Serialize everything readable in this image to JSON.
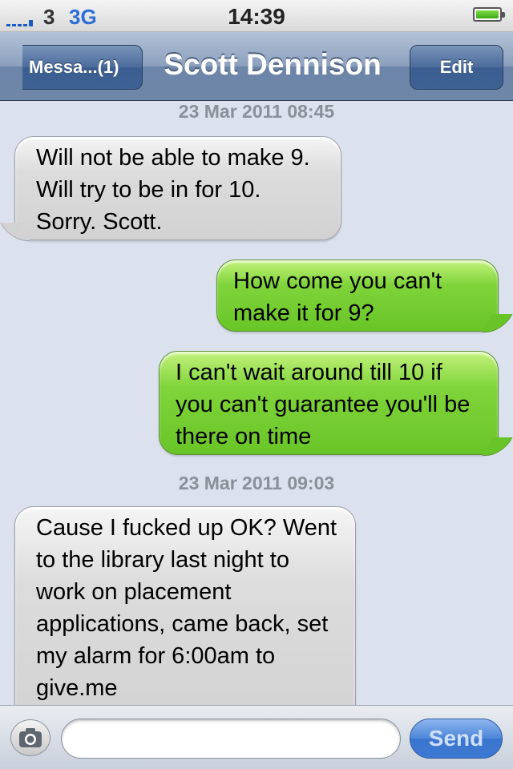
{
  "status_bar": {
    "carrier": "3",
    "network": "3G",
    "time": "14:39",
    "battery_level": 1.0
  },
  "nav": {
    "back_label": "Messa...(1)",
    "title": "Scott Dennison",
    "edit_label": "Edit"
  },
  "messages": [
    {
      "type": "timestamp",
      "text": "23 Mar 2011 08:45"
    },
    {
      "type": "incoming",
      "text": "Will not be able to make 9. Will try to be in for 10. Sorry. Scott."
    },
    {
      "type": "outgoing",
      "text": "How come you can't make it for 9?"
    },
    {
      "type": "outgoing",
      "text": "I can't wait around till 10 if you can't guarantee you'll be there on time"
    },
    {
      "type": "timestamp",
      "text": "23 Mar 2011 09:03"
    },
    {
      "type": "incoming",
      "text": "Cause I fucked up OK? Went to the library last night to work on placement applications, came back, set my alarm for 6:00am to give.me"
    }
  ],
  "composer": {
    "value": "",
    "send_label": "Send"
  },
  "colors": {
    "incoming_bubble": "#d2d2d2",
    "outgoing_bubble": "#69c527",
    "nav_bar": "#6e86a8"
  },
  "icons": {
    "camera": "camera-icon",
    "back": "chevron-left-icon",
    "battery": "battery-icon",
    "signal": "signal-icon"
  }
}
